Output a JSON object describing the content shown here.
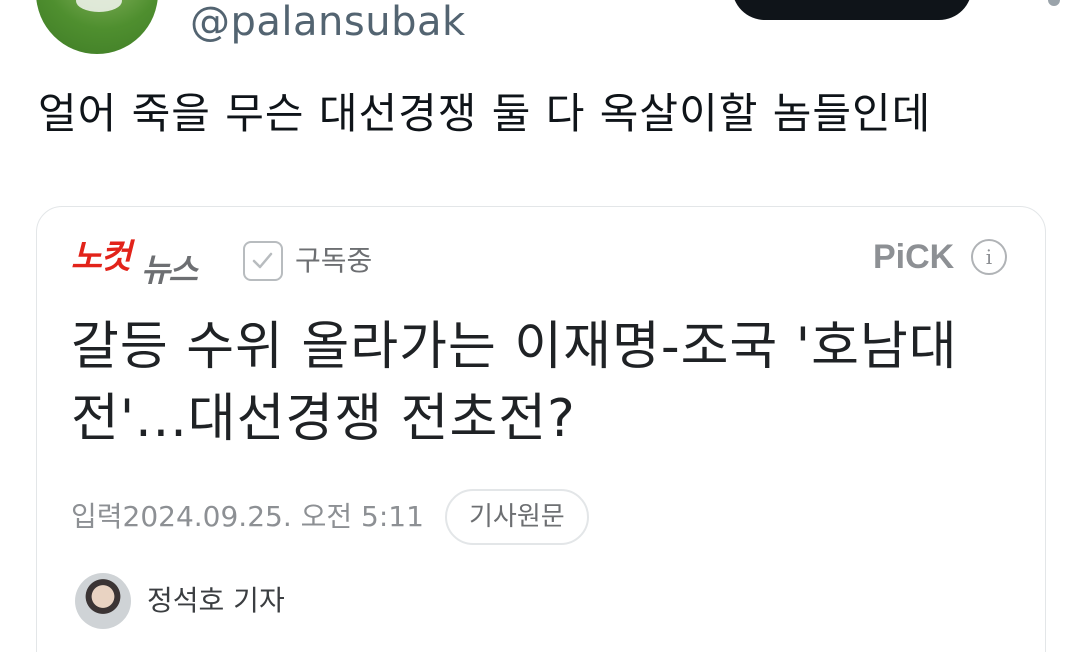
{
  "tweet": {
    "handle": "@palansubak",
    "text": "얼어 죽을 무슨 대선경쟁 둘 다 옥살이할 놈들인데"
  },
  "article_card": {
    "logo_red": "노컷",
    "logo_gray": "뉴스",
    "subscribe_label": "구독중",
    "pick_label": "PiCK",
    "info_icon": "i",
    "headline": "갈등 수위 올라가는 이재명-조국 '호남대전'...대선경쟁 전초전?",
    "date_line": "입력2024.09.25. 오전 5:11",
    "original_button": "기사원문",
    "reporter": "정석호 기자"
  },
  "icons": {
    "avatar": "user-avatar",
    "more": "more-icon",
    "check": "check-icon",
    "info": "info-icon",
    "reporter_avatar": "reporter-avatar"
  },
  "colors": {
    "handle": "#536471",
    "logo_red": "#e2231a",
    "logo_gray": "#6d6f72",
    "text": "#0f1419"
  }
}
